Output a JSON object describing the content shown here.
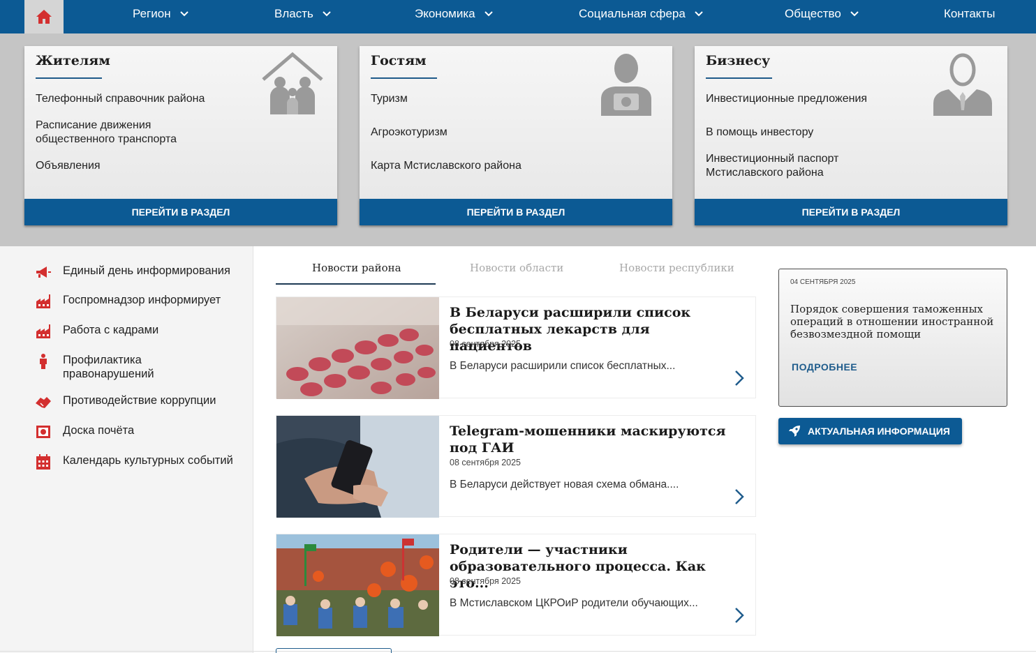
{
  "colors": {
    "nav_bg": "#0c5a94",
    "accent_red": "#d32f2f",
    "cards_bg": "#c5c5c5",
    "sidebar_bg": "#f4f4f4"
  },
  "nav": {
    "home_icon": "home-icon",
    "items": [
      {
        "label": "Регион",
        "has_dropdown": true
      },
      {
        "label": "Власть",
        "has_dropdown": true
      },
      {
        "label": "Экономика",
        "has_dropdown": true
      },
      {
        "label": "Социальная сфера",
        "has_dropdown": true
      },
      {
        "label": "Общество",
        "has_dropdown": true
      },
      {
        "label": "Контакты",
        "has_dropdown": false
      }
    ]
  },
  "cards": [
    {
      "title": "Жителям",
      "icon": "family-house-icon",
      "links": [
        "Телефонный справочник района",
        "Расписание движения общественного транспорта",
        "Объявления"
      ],
      "button": "ПЕРЕЙТИ В РАЗДЕЛ"
    },
    {
      "title": "Гостям",
      "icon": "tourist-camera-icon",
      "links": [
        "Туризм",
        "Агроэкотуризм",
        "Карта Мстиславского района"
      ],
      "button": "ПЕРЕЙТИ В РАЗДЕЛ"
    },
    {
      "title": "Бизнесу",
      "icon": "businessman-icon",
      "links": [
        "Инвестиционные предложения",
        "В помощь инвестору",
        "Инвестиционный паспорт Мстиславского района"
      ],
      "button": "ПЕРЕЙТИ В РАЗДЕЛ"
    }
  ],
  "sidebar": {
    "items": [
      {
        "label": "Единый день информирования",
        "icon": "megaphone-icon"
      },
      {
        "label": "Госпромнадзор информирует",
        "icon": "factory-icon"
      },
      {
        "label": "Работа с кадрами",
        "icon": "factory-icon"
      },
      {
        "label": "Профилактика правонарушений",
        "icon": "person-icon"
      },
      {
        "label": "Противодействие коррупции",
        "icon": "handshake-icon"
      },
      {
        "label": "Доска почёта",
        "icon": "award-board-icon"
      },
      {
        "label": "Календарь культурных событий",
        "icon": "calendar-icon"
      }
    ]
  },
  "tabs": [
    {
      "label": "Новости района",
      "active": true
    },
    {
      "label": "Новости области",
      "active": false
    },
    {
      "label": "Новости республики",
      "active": false
    }
  ],
  "news": [
    {
      "title": "В Беларуси расширили список бесплатных лекарств для пациентов",
      "date": "08 сентября 2025",
      "excerpt": "В Беларуси расширили список бесплатных...",
      "image": "pills-photo"
    },
    {
      "title": "Telegram-мошенники маскируются под ГАИ",
      "date": "08 сентября 2025",
      "excerpt": "В Беларуси действует новая схема обмана....",
      "image": "phone-hand-photo"
    },
    {
      "title": "Родители — участники образовательного процесса. Как это...",
      "date": "08 сентября 2025",
      "excerpt": "В Мстиславском ЦКРОиР родители обучающих...",
      "image": "crowd-balloons-photo"
    }
  ],
  "info_box": {
    "date": "04 СЕНТЯБРЯ 2025",
    "title": "Порядок совершения таможенных операций в отношении иностранной безвозмездной помощи",
    "more": "ПОДРОБНЕЕ"
  },
  "actual_button": {
    "label": "АКТУАЛЬНАЯ ИНФОРМАЦИЯ",
    "icon": "rocket-icon"
  }
}
